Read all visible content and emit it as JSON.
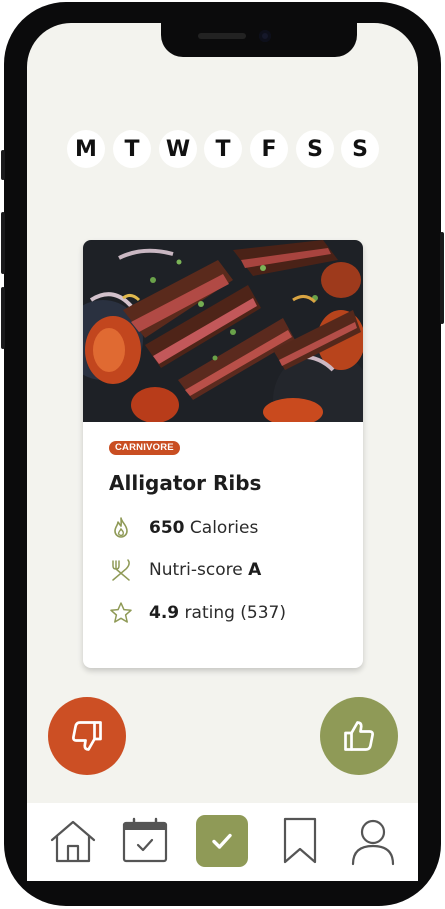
{
  "week": {
    "days": [
      "M",
      "T",
      "W",
      "T",
      "F",
      "S",
      "S"
    ]
  },
  "recipe_card": {
    "image_alt": "sliced grilled steak with peppers and onions",
    "tag": "CARNIVORE",
    "title": "Alligator Ribs",
    "calories_value": "650",
    "calories_label": "Calories",
    "nutri_label": "Nutri-score",
    "nutri_value": "A",
    "rating_value": "4.9",
    "rating_label": "rating (537)",
    "icons": [
      "flame-icon",
      "fork-knife-icon",
      "star-icon"
    ]
  },
  "actions": {
    "dislike_icon": "thumbs-down-icon",
    "like_icon": "thumbs-up-icon"
  },
  "bottom_nav": {
    "items": [
      {
        "icon": "home-icon"
      },
      {
        "icon": "calendar-check-icon"
      },
      {
        "icon": "check-icon",
        "active": true
      },
      {
        "icon": "bookmark-icon"
      },
      {
        "icon": "user-icon"
      }
    ]
  },
  "colors": {
    "accent_orange": "#cc4f24",
    "accent_olive": "#8f9a57",
    "screen_background": "#f3f3ee"
  }
}
